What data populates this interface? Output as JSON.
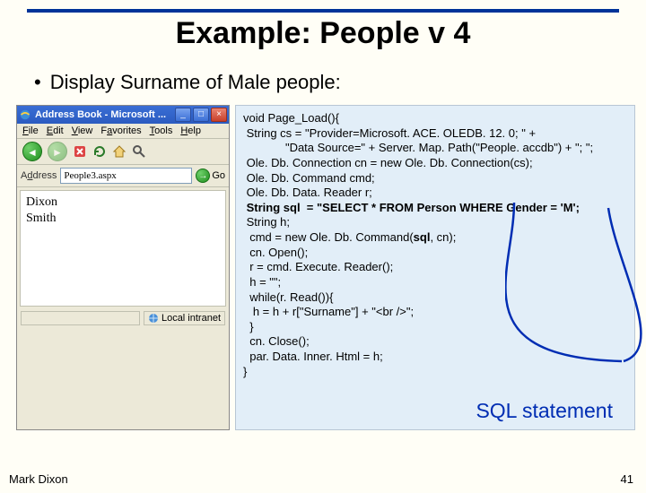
{
  "slide": {
    "title": "Example: People v 4",
    "bullet": "Display Surname of Male people:",
    "footer_author": "Mark Dixon",
    "page_number": "41"
  },
  "browser": {
    "window_title": "Address Book - Microsoft ...",
    "menus": {
      "file": "File",
      "edit": "Edit",
      "view": "View",
      "favorites": "Favorites",
      "tools": "Tools",
      "help": "Help"
    },
    "address_label": "Address",
    "address_value": "People3.aspx",
    "go_label": "Go",
    "page_lines": [
      "Dixon",
      "Smith"
    ],
    "status_label": "Local intranet"
  },
  "code": {
    "lines": [
      "void Page_Load(){",
      " String cs = \"Provider=Microsoft. ACE. OLEDB. 12. 0; \" +",
      "             \"Data Source=\" + Server. Map. Path(\"People. accdb\") + \"; \";",
      " Ole. Db. Connection cn = new Ole. Db. Connection(cs);",
      " Ole. Db. Command cmd;",
      " Ole. Db. Data. Reader r;",
      " String sql  = \"SELECT * FROM Person WHERE Gender = 'M';",
      " String h;",
      "  cmd = new Ole. Db. Command(sql, cn);",
      "  cn. Open();",
      "  r = cmd. Execute. Reader();",
      "  h = \"\";",
      "  while(r. Read()){",
      "   h = h + r[\"Surname\"] + \"<br />\";",
      "  }",
      "  cn. Close();",
      "  par. Data. Inner. Html = h;",
      "}"
    ],
    "callout_label": "SQL statement"
  },
  "icons": {
    "ie": "ie-icon",
    "min": "minimize-icon",
    "max": "maximize-icon",
    "close": "close-icon",
    "back": "back-icon",
    "fwd": "forward-icon",
    "stop": "stop-icon",
    "refresh": "refresh-icon",
    "go": "go-icon",
    "search": "search-icon",
    "zone": "intranet-icon"
  }
}
